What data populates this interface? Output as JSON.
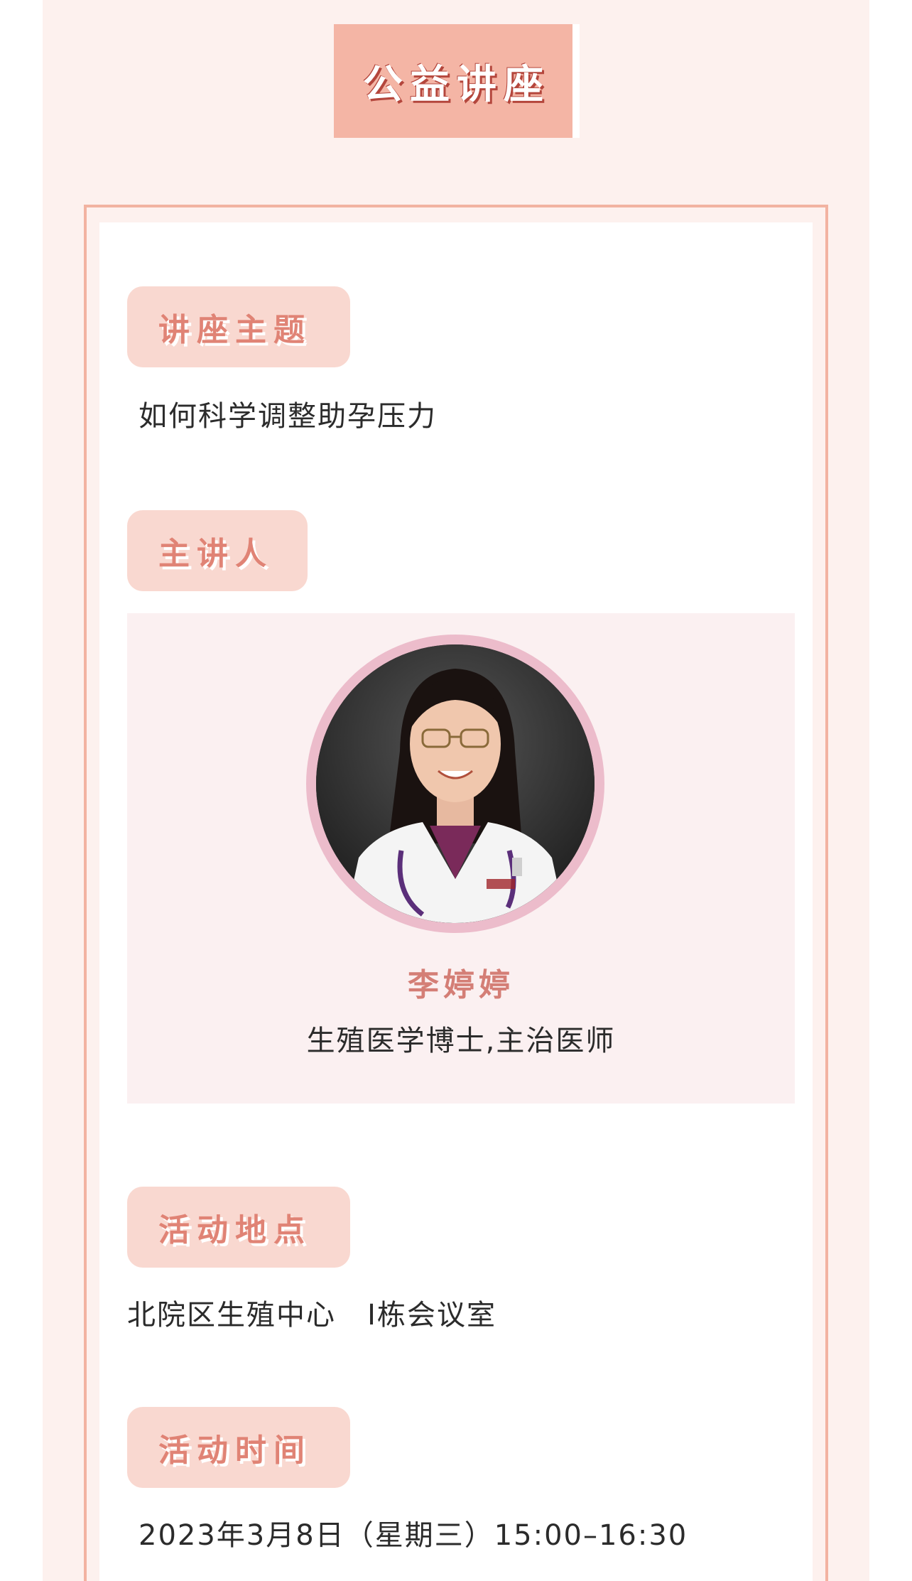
{
  "header": {
    "title": "公益讲座"
  },
  "sections": {
    "topic": {
      "label": "讲座主题",
      "value": "如何科学调整助孕压力"
    },
    "speaker": {
      "label": "主讲人",
      "name": "李婷婷",
      "title": "生殖医学博士,主治医师",
      "photo_icon": "doctor-portrait"
    },
    "location": {
      "label": "活动地点",
      "value": "北院区生殖中心   I栋会议室"
    },
    "time": {
      "label": "活动时间",
      "value": "2023年3月8日（星期三）15:00–16:30"
    }
  },
  "colors": {
    "page_bg": "#fdf1ee",
    "banner": "#f4b5a5",
    "pill_bg": "#f9d8d0",
    "accent_text": "#e08375",
    "frame": "#f2b3a1",
    "speaker_bg": "#fbf0f1"
  }
}
